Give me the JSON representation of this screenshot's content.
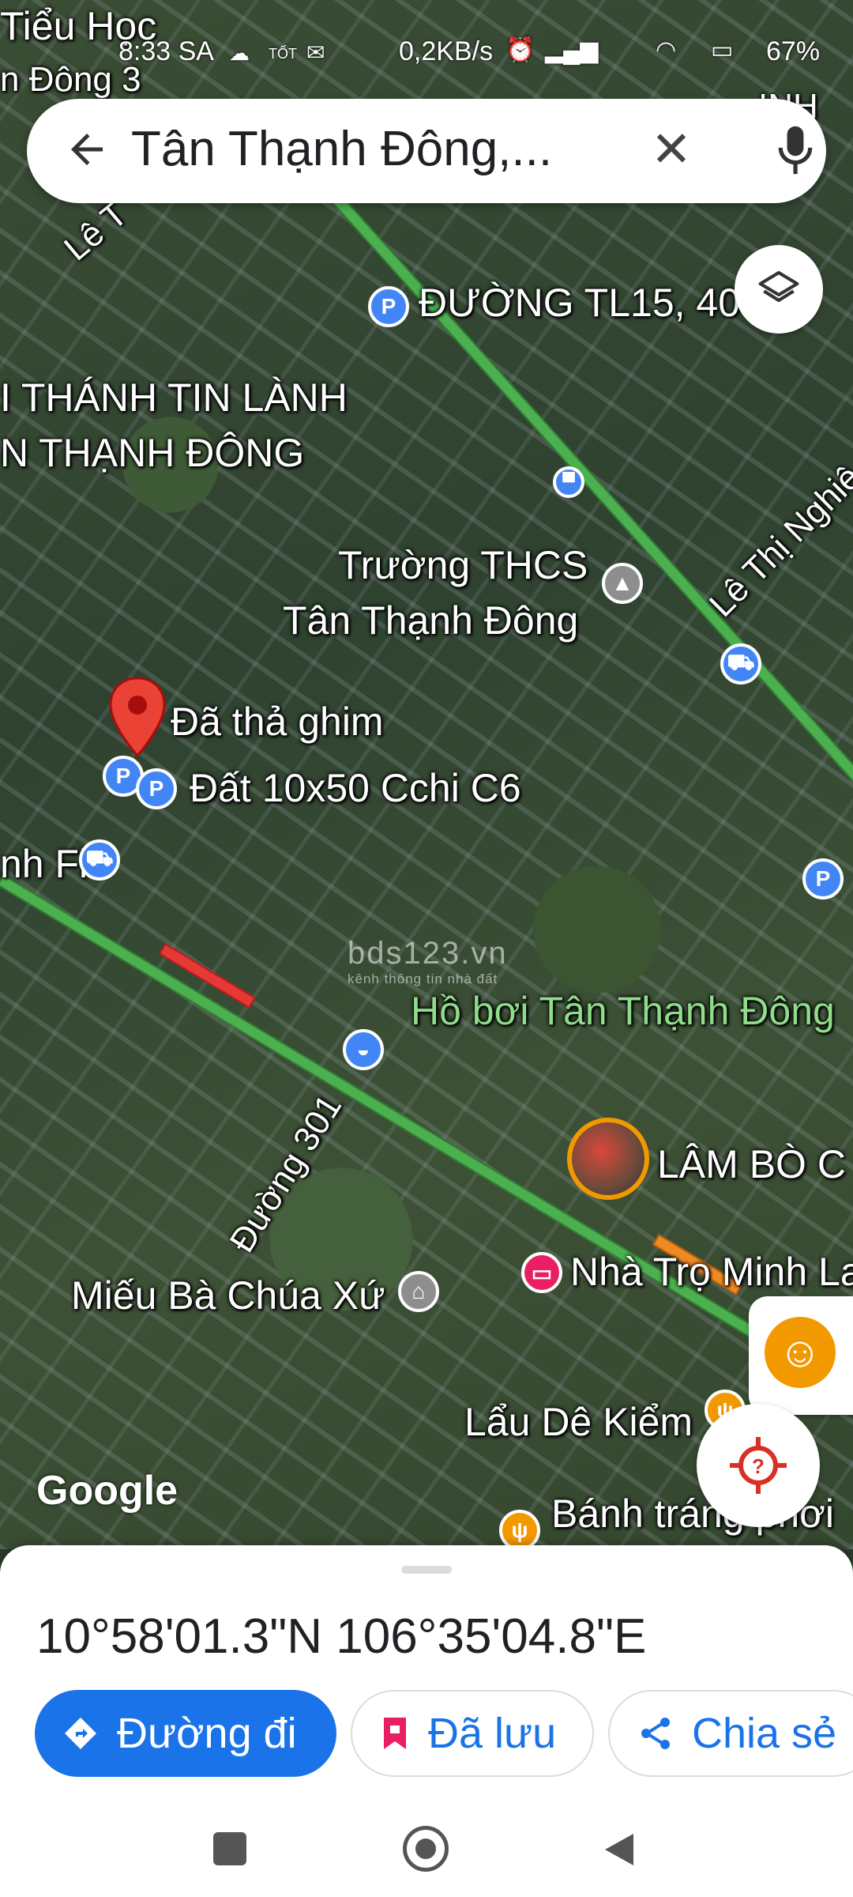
{
  "status_bar": {
    "time": "8:33 SA",
    "carrier": "TỐT",
    "speed": "0,2KB/s",
    "battery": "67%"
  },
  "search": {
    "query": "Tân Thạnh Đông,..."
  },
  "map_labels": {
    "tieu_hoc_1": "Tiểu Học",
    "tieu_hoc_2": "n Đông 3",
    "le": "Lê T",
    "duong_tl15": "ĐƯỜNG TL15, 40",
    "tin_lanh_1": "I THÁNH TIN LÀNH",
    "tin_lanh_2": "N THẠNH ĐÔNG",
    "le_thi_nghie": "Lê Thị Nghiê",
    "thcs_1": "Trường THCS",
    "thcs_2": "Tân Thạnh Đông",
    "dropped_pin": "Đã thả ghim",
    "dat": "Đất 10x50 Cchi C6",
    "nh_fi": "nh Fi",
    "ho_boi": "Hồ bơi Tân Thạnh Đông",
    "lam_bo": "LÂM BÒ C",
    "duong_301": "Đường 301",
    "nha_tro": "Nhà Trọ Minh La",
    "mieu": "Miếu Bà Chúa Xứ",
    "lau_de": "Lẩu Dê Kiểm",
    "banh_trang": "Bánh tráng phơi",
    "top_right": "INH",
    "google": "Google"
  },
  "watermark": {
    "main": "bds123.vn",
    "sub": "kênh thông tin nhà đất"
  },
  "place": {
    "coordinates": "10°58'01.3\"N 106°35'04.8\"E"
  },
  "actions": {
    "directions": "Đường đi",
    "saved": "Đã lưu",
    "share": "Chia sẻ"
  },
  "colors": {
    "primary": "#1a73e8",
    "pin": "#ea4335",
    "traffic_green": "#4caf50",
    "traffic_red": "#e53935"
  }
}
